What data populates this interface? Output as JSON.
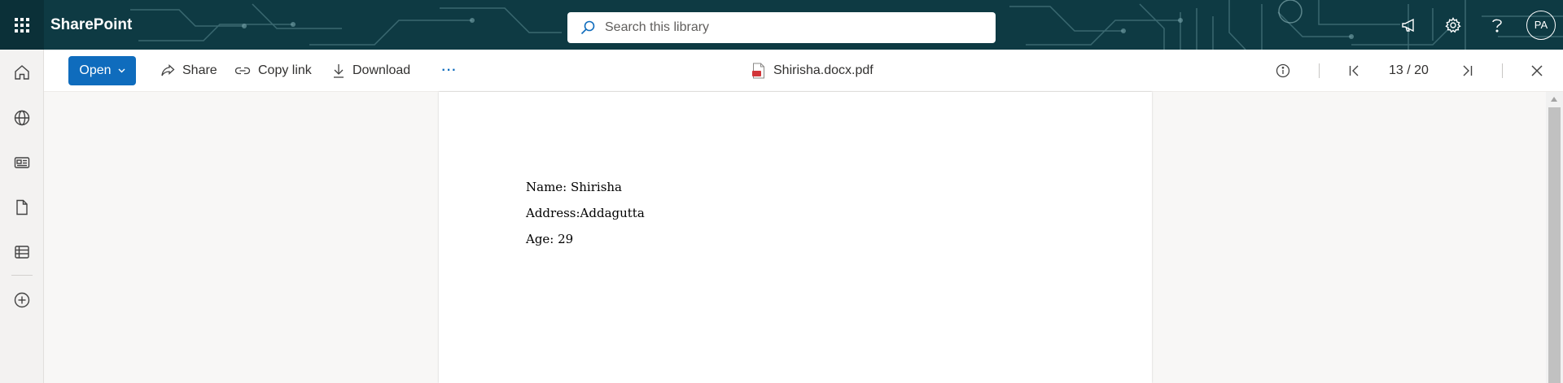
{
  "suite_bar": {
    "app_name": "SharePoint",
    "search_placeholder": "Search this library",
    "user_initials": "PA"
  },
  "left_rail": {
    "items": [
      "home-icon",
      "globe-icon",
      "news-icon",
      "files-icon",
      "lists-icon",
      "create-icon"
    ]
  },
  "command_bar": {
    "open_label": "Open",
    "share_label": "Share",
    "copy_link_label": "Copy link",
    "download_label": "Download",
    "more_label": "···",
    "file_name": "Shirisha.docx.pdf",
    "current_page": "13 / 20"
  },
  "document": {
    "lines": [
      "Name: Shirisha",
      "Address:Addagutta",
      "Age: 29"
    ]
  },
  "colors": {
    "suite_bar": "#0e3a43",
    "accent": "#0f6cbd"
  }
}
